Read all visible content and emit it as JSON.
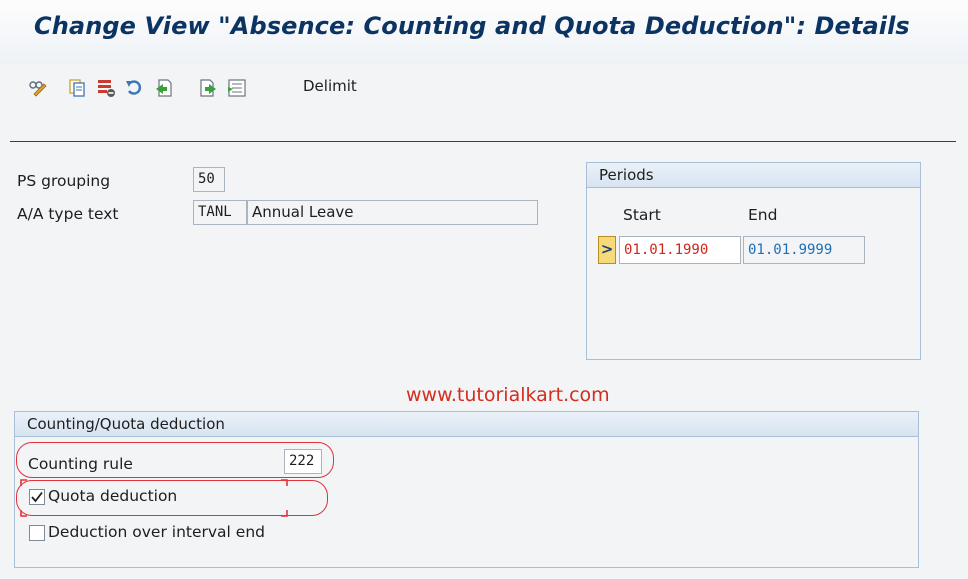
{
  "title": "Change View \"Absence: Counting and Quota Deduction\": Details",
  "toolbar": {
    "icons": [
      "display-change-icon",
      "copy-icon",
      "delete-icon",
      "undo-icon",
      "previous-entry-icon",
      "next-entry-icon",
      "select-all-icon"
    ],
    "delimit_label": "Delimit"
  },
  "form": {
    "ps_grouping_label": "PS grouping",
    "ps_grouping_value": "50",
    "aa_type_label": "A/A type text",
    "aa_type_code": "TANL",
    "aa_type_text": "Annual Leave"
  },
  "periods": {
    "header": "Periods",
    "start_label": "Start",
    "end_label": "End",
    "arrow": ">",
    "start_value": "01.01.1990",
    "end_value": "01.01.9999",
    "start_color": "#d0261c",
    "end_color": "#1f6fb3"
  },
  "watermark": "www.tutorialkart.com",
  "counting": {
    "header": "Counting/Quota deduction",
    "rule_label": "Counting rule",
    "rule_value": "222",
    "quota_label": "Quota deduction",
    "quota_checked": true,
    "interval_label": "Deduction over interval end",
    "interval_checked": false
  }
}
